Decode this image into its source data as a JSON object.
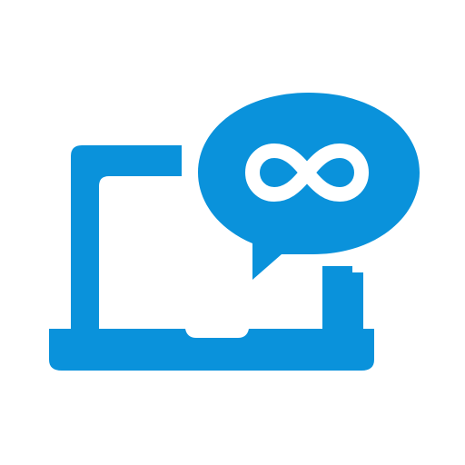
{
  "icon": {
    "name": "laptop-chat-infinity-icon",
    "parts": [
      "laptop-icon",
      "speech-bubble-icon",
      "infinity-icon"
    ]
  },
  "colors": {
    "background": "#ffffff",
    "primary": "#0a92db",
    "glyph": "#ffffff"
  }
}
